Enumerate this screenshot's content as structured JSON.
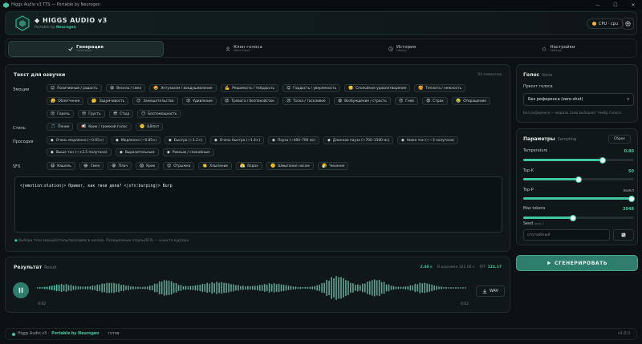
{
  "window": {
    "title": "Higgs Audio v3 TTS — Portable by Neurogen",
    "controls": [
      "—",
      "☐",
      "✕"
    ]
  },
  "header": {
    "title": "HIGGS AUDIO v3",
    "subtitle_prefix": "Portable by",
    "subtitle_brand": "Neurogen",
    "device": "CPU · cpu",
    "device_color": "#f1b43a"
  },
  "tabs": [
    {
      "label": "Генерация",
      "sub": "Generation",
      "active": true
    },
    {
      "label": "Клон голоса",
      "sub": "Voice Clone",
      "active": false
    },
    {
      "label": "История",
      "sub": "History",
      "active": false
    },
    {
      "label": "Настройки",
      "sub": "Settings",
      "active": false
    }
  ],
  "text_panel": {
    "title": "Текст для озвучки",
    "char_count": "64 символов",
    "emotions_label": "Эмоции",
    "emotions": [
      {
        "icon": "😊",
        "label": "Позитивный / радость"
      },
      {
        "icon": "😄",
        "label": "Весело / смех"
      },
      {
        "icon": "🤩",
        "label": "Энтузиазм / воодушевление"
      },
      {
        "icon": "💪",
        "label": "Решимость / твёрдость"
      },
      {
        "icon": "😌",
        "label": "Гордость / уверенность"
      },
      {
        "icon": "🙂",
        "label": "Спокойное удовлетворение"
      },
      {
        "icon": "🥰",
        "label": "Теплота / нежность"
      },
      {
        "icon": "😮‍💨",
        "label": "Облегчение"
      },
      {
        "icon": "🤔",
        "label": "Задумчивость"
      },
      {
        "icon": "😕",
        "label": "Замешательство"
      },
      {
        "icon": "😲",
        "label": "Удивление"
      },
      {
        "icon": "😟",
        "label": "Тревога / беспокойство"
      },
      {
        "icon": "😢",
        "label": "Тоска / тоскливое"
      },
      {
        "icon": "😆",
        "label": "Возбуждение / страсть"
      },
      {
        "icon": "😠",
        "label": "Гнев"
      },
      {
        "icon": "😨",
        "label": "Страх"
      },
      {
        "icon": "🤢",
        "label": "Отвращение"
      },
      {
        "icon": "😣",
        "label": "Горечь"
      },
      {
        "icon": "😔",
        "label": "Грусть"
      },
      {
        "icon": "😳",
        "label": "Стыд"
      },
      {
        "icon": "😶",
        "label": "Беспомощность"
      }
    ],
    "style_label": "Стиль",
    "styles": [
      {
        "icon": "🎵",
        "label": "Пение"
      },
      {
        "icon": "📢",
        "label": "Крик / громкий голос"
      },
      {
        "icon": "🤫",
        "label": "Шёпот"
      }
    ],
    "prosody_label": "Просодия",
    "prosody": [
      {
        "icon": "◆",
        "label": "Очень медленно (~0.65×)"
      },
      {
        "icon": "◆",
        "label": "Медленно (~0.85×)"
      },
      {
        "icon": "◆",
        "label": "Быстро (~1.2×)"
      },
      {
        "icon": "◆",
        "label": "Очень быстро (~1.4×)"
      },
      {
        "icon": "◆",
        "label": "Пауза (~400–700 мс)"
      },
      {
        "icon": "◆",
        "label": "Длинная пауза (~700–1500 мс)"
      },
      {
        "icon": "◆",
        "label": "Ниже тон (~−3 полутона)"
      },
      {
        "icon": "◆",
        "label": "Выше тон (~+2.5 полутона)"
      },
      {
        "icon": "◆",
        "label": "Выразительным"
      },
      {
        "icon": "◆",
        "label": "Ровным / спокойным"
      }
    ],
    "sfx_label": "SFX",
    "sfx": [
      {
        "icon": "😷",
        "label": "Кашель"
      },
      {
        "icon": "😂",
        "label": "Смех"
      },
      {
        "icon": "😭",
        "label": "Плач"
      },
      {
        "icon": "😱",
        "label": "Крик"
      },
      {
        "icon": "😮",
        "label": "Отрыжка"
      },
      {
        "icon": "👏",
        "label": "Хлыпание"
      },
      {
        "icon": "😤",
        "label": "Вздох"
      },
      {
        "icon": "🤫",
        "label": "Шмыгание носом"
      },
      {
        "icon": "🤧",
        "label": "Чихание"
      }
    ],
    "text_value": "<|emotion:elation|> Привет, как твои дела? <|sfx:burping|> Burp",
    "hint": "Выбери теги эмоций/стиль/просодию в начало. Позиционные (паузы/SFX) — в место курсора."
  },
  "voice_panel": {
    "title": "Голос",
    "title_sub": "Voice",
    "preset_label": "Пресет голоса",
    "preset_value": "Без референса (zero-shot)",
    "preset_hint": "Без референса — модель сама выбирает тембр голоса."
  },
  "params_panel": {
    "title": "Параметры",
    "title_sub": "Sampling",
    "reset_label": "Сброс",
    "temperature": {
      "label": "Temperature",
      "value": "0.80",
      "fraction": 0.72
    },
    "top_k": {
      "label": "Top-K",
      "value": "50",
      "fraction": 0.5
    },
    "top_p": {
      "label": "Top-P",
      "value": "выкл",
      "fraction": 0.98
    },
    "max_tokens": {
      "label": "Max tokens",
      "value": "2048",
      "fraction": 0.45
    },
    "seed": {
      "label": "Seed",
      "label_sub": "(опц.)",
      "placeholder": "случайный"
    }
  },
  "generate": {
    "label": "СГЕНЕРИРОВАТЬ"
  },
  "result_panel": {
    "title": "Результат",
    "title_sub": "Result",
    "duration": "2.40 с",
    "generated_label": "В дорожке 321.06 с",
    "rtf_label": "RTF",
    "rtf": "124.17",
    "time_start": "0:02",
    "time_end": "0:02",
    "download_label": "WAV"
  },
  "footer": {
    "brand": "Higgs Audio v3 ·",
    "brand_accent": "Portable by Neurogen",
    "status": "готов",
    "version": "v1.0.0"
  },
  "colors": {
    "accent": "#3ec7a2",
    "background": "#0b1114",
    "panel": "#0f1719"
  }
}
